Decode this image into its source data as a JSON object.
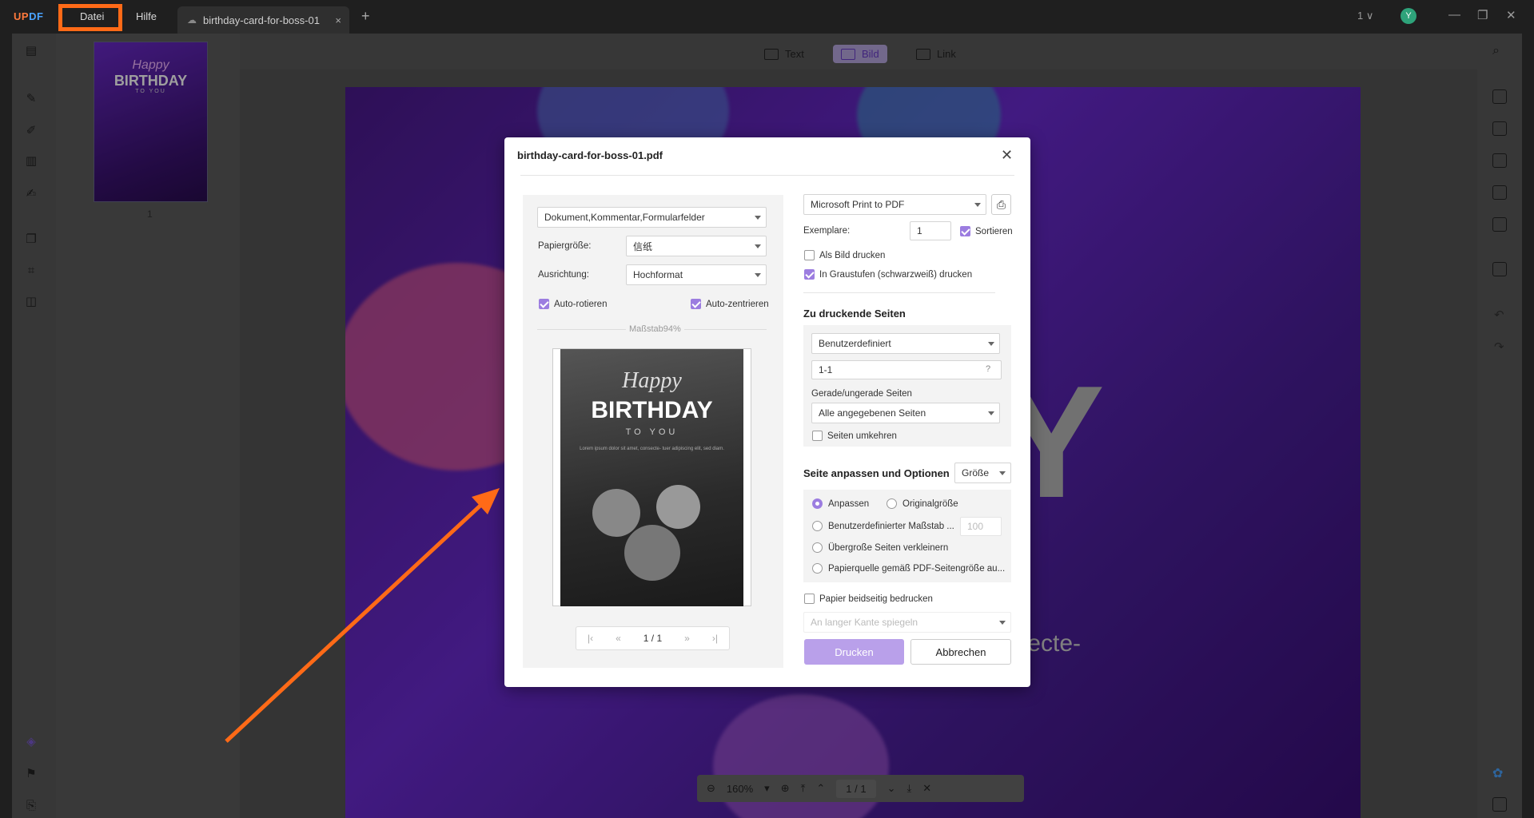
{
  "app": {
    "logo_u": "UP",
    "logo_p": "DF"
  },
  "menu": {
    "file": "Datei",
    "help": "Hilfe"
  },
  "tab": {
    "title": "birthday-card-for-boss-01",
    "close": "×",
    "new": "+"
  },
  "titlebar": {
    "page_selector": "1 ∨",
    "avatar_letter": "Y",
    "minimize": "—",
    "restore": "❐",
    "close": "✕"
  },
  "toolbar": {
    "text": "Text",
    "image": "Bild",
    "link": "Link"
  },
  "thumbnail": {
    "page_number": "1",
    "happy": "Happy",
    "birthday": "BIRTHDAY",
    "to_you": "TO YOU"
  },
  "document": {
    "big_letters": "AY",
    "line": "ecte-"
  },
  "zoom": {
    "value": "160%",
    "page_current": "1",
    "page_sep": "/",
    "page_total": "1"
  },
  "dialog": {
    "title": "birthday-card-for-boss-01.pdf",
    "content_select": "Dokument,Kommentar,Formularfelder",
    "paper_size_label": "Papiergröße:",
    "paper_size_value": "信纸",
    "orientation_label": "Ausrichtung:",
    "orientation_value": "Hochformat",
    "auto_rotate": "Auto-rotieren",
    "auto_center": "Auto-zentrieren",
    "scale": "Maßstab94%",
    "preview": {
      "happy": "Happy",
      "birthday": "BIRTHDAY",
      "to_you": "TO YOU",
      "small": "Lorem ipsum dolor sit amet, consecte- tuer adipiscing elit, sed diam."
    },
    "preview_nav": {
      "first": "|‹",
      "prev": "«",
      "current": "1",
      "sep": "/",
      "total": "1",
      "next": "»",
      "last": "›|"
    },
    "printer": "Microsoft Print to PDF",
    "copies_label": "Exemplare:",
    "copies_value": "1",
    "collate": "Sortieren",
    "print_as_image": "Als Bild drucken",
    "grayscale": "In Graustufen (schwarzweiß) drucken",
    "pages_heading": "Zu druckende Seiten",
    "pages_mode": "Benutzerdefiniert",
    "pages_range": "1-1",
    "odd_even_label": "Gerade/ungerade Seiten",
    "odd_even_value": "Alle angegebenen Seiten",
    "reverse": "Seiten umkehren",
    "fit_heading": "Seite anpassen und Optionen",
    "fit_select": "Größe",
    "fit": "Anpassen",
    "original": "Originalgröße",
    "custom_scale": "Benutzerdefinierter Maßstab ...",
    "custom_scale_value": "100",
    "shrink": "Übergroße Seiten verkleinern",
    "paper_source": "Papierquelle gemäß PDF-Seitengröße au...",
    "duplex": "Papier beidseitig bedrucken",
    "duplex_mode": "An langer Kante spiegeln",
    "print_button": "Drucken",
    "cancel_button": "Abbrechen"
  },
  "colors": {
    "accent": "#9c7de0",
    "highlight": "#ff6a17",
    "doc_bg": "#5a22b5"
  }
}
